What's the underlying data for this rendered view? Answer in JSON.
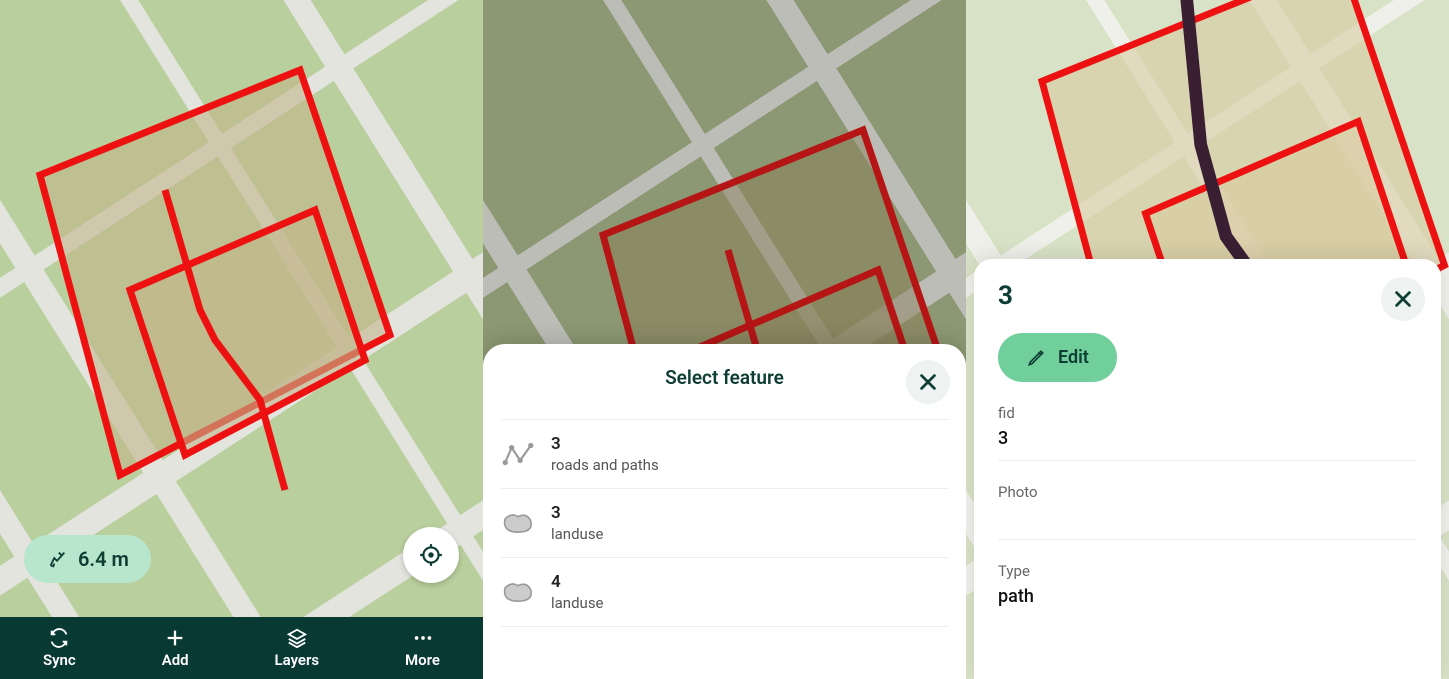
{
  "phone1": {
    "distance": "6.4 m",
    "bottom": {
      "sync": "Sync",
      "add": "Add",
      "layers": "Layers",
      "more": "More"
    }
  },
  "phone2": {
    "sheet_title": "Select feature",
    "features": [
      {
        "fid": "3",
        "layer": "roads and paths",
        "geom": "line"
      },
      {
        "fid": "3",
        "layer": "landuse",
        "geom": "polygon"
      },
      {
        "fid": "4",
        "layer": "landuse",
        "geom": "polygon"
      }
    ]
  },
  "phone3": {
    "title": "3",
    "edit_label": "Edit",
    "fields": {
      "fid_label": "fid",
      "fid_value": "3",
      "photo_label": "Photo",
      "photo_value": "",
      "type_label": "Type",
      "type_value": "path"
    }
  }
}
